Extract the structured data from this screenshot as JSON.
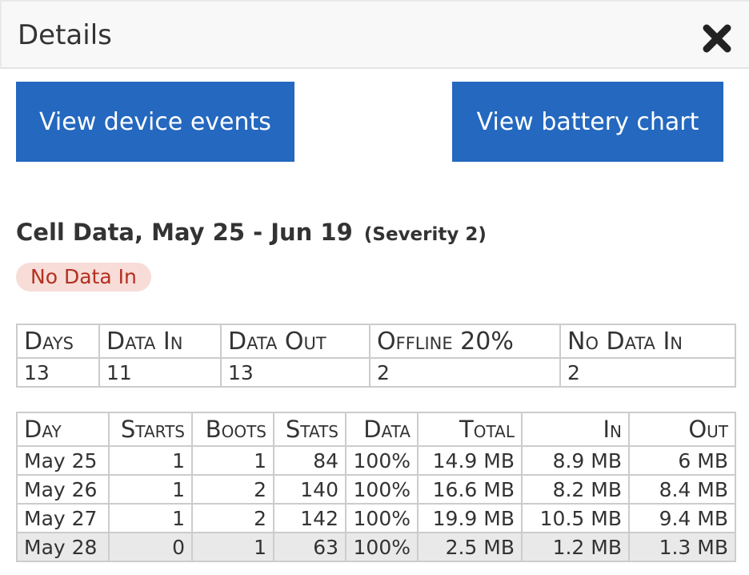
{
  "panel": {
    "title": "Details",
    "close_icon": "close-x-icon"
  },
  "buttons": {
    "events_label": "View device events",
    "battery_label": "View battery chart",
    "color": "#2468bf"
  },
  "section": {
    "title": "Cell Data, May 25 - Jun 19",
    "severity": "(Severity 2)",
    "badge": "No Data In"
  },
  "summary": {
    "headers": [
      "Days",
      "Data In",
      "Data Out",
      "Offline 20%",
      "No Data In"
    ],
    "values": [
      "13",
      "11",
      "13",
      "2",
      "2"
    ]
  },
  "daily": {
    "headers": [
      "Day",
      "Starts",
      "Boots",
      "Stats",
      "Data",
      "Total",
      "In",
      "Out"
    ],
    "rows": [
      [
        "May 25",
        "1",
        "1",
        "84",
        "100%",
        "14.9 MB",
        "8.9 MB",
        "6 MB"
      ],
      [
        "May 26",
        "1",
        "2",
        "140",
        "100%",
        "16.6 MB",
        "8.2 MB",
        "8.4 MB"
      ],
      [
        "May 27",
        "1",
        "2",
        "142",
        "100%",
        "19.9 MB",
        "10.5 MB",
        "9.4 MB"
      ],
      [
        "May 28",
        "0",
        "1",
        "63",
        "100%",
        "2.5 MB",
        "1.2 MB",
        "1.3 MB"
      ]
    ]
  }
}
